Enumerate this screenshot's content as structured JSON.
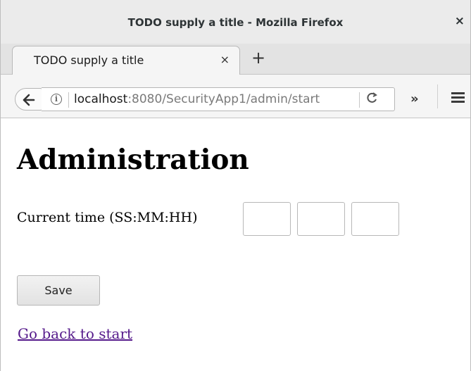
{
  "window": {
    "title": "TODO supply a title - Mozilla Firefox",
    "close_glyph": "×"
  },
  "tabs": [
    {
      "title": "TODO supply a title",
      "close_glyph": "×",
      "active": true
    }
  ],
  "new_tab_glyph": "+",
  "navbar": {
    "url_host": "localhost",
    "url_rest": ":8080/SecurityApp1/admin/start",
    "reload_glyph": "C",
    "overflow_glyph": "»"
  },
  "page": {
    "heading": "Administration",
    "time_label": "Current time (SS:MM:HH)",
    "time_inputs": [
      {
        "value": ""
      },
      {
        "value": ""
      },
      {
        "value": ""
      }
    ],
    "save_label": "Save",
    "back_link": "Go back to start"
  },
  "colors": {
    "link_visited": "#551a8b",
    "chrome_bg": "#ebebeb"
  }
}
